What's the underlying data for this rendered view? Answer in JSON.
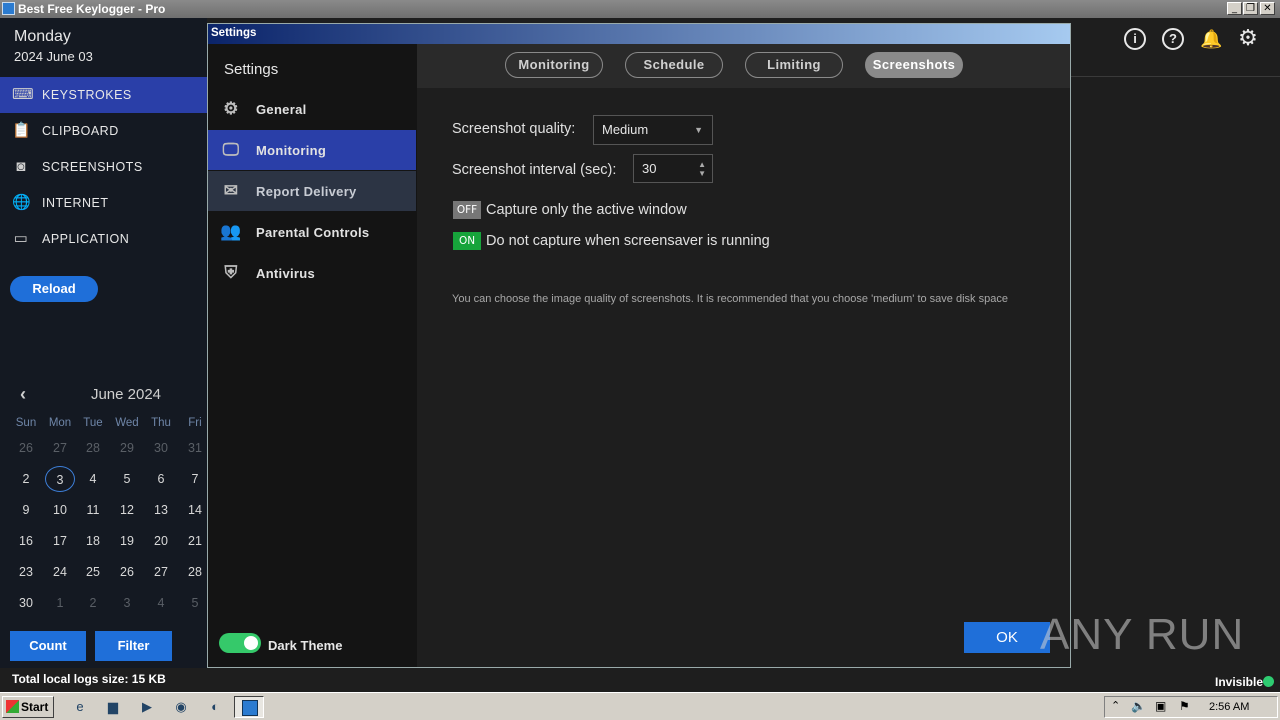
{
  "window": {
    "title": "Best Free Keylogger - Pro"
  },
  "app": {
    "day": "Monday",
    "date": "2024 June 03",
    "nav": [
      {
        "label": "KEYSTROKES",
        "icon": "keyboard-icon",
        "active": true
      },
      {
        "label": "CLIPBOARD",
        "icon": "clipboard-icon",
        "active": false
      },
      {
        "label": "SCREENSHOTS",
        "icon": "camera-icon",
        "active": false
      },
      {
        "label": "INTERNET",
        "icon": "globe-icon",
        "active": false
      },
      {
        "label": "APPLICATION",
        "icon": "window-icon",
        "active": false
      }
    ],
    "reload_label": "Reload",
    "calendar": {
      "month": "June 2024",
      "weekdays": [
        "Sun",
        "Mon",
        "Tue",
        "Wed",
        "Thu",
        "Fri"
      ],
      "weeks": [
        [
          "26",
          "27",
          "28",
          "29",
          "30",
          "31"
        ],
        [
          "2",
          "3",
          "4",
          "5",
          "6",
          "7"
        ],
        [
          "9",
          "10",
          "11",
          "12",
          "13",
          "14"
        ],
        [
          "16",
          "17",
          "18",
          "19",
          "20",
          "21"
        ],
        [
          "23",
          "24",
          "25",
          "26",
          "27",
          "28"
        ],
        [
          "30",
          "1",
          "2",
          "3",
          "4",
          "5"
        ]
      ],
      "selected": "3"
    },
    "count_label": "Count",
    "filter_label": "Filter",
    "logs_size": "Total local logs size: 15 KB",
    "status": "Invisible",
    "status_color": "#2ecc71"
  },
  "settings": {
    "title": "Settings",
    "sidebar_heading": "Settings",
    "items": [
      {
        "label": "General",
        "icon": "gear-icon"
      },
      {
        "label": "Monitoring",
        "icon": "monitor-icon"
      },
      {
        "label": "Report Delivery",
        "icon": "envelope-icon"
      },
      {
        "label": "Parental Controls",
        "icon": "users-icon"
      },
      {
        "label": "Antivirus",
        "icon": "shield-window-icon"
      }
    ],
    "dark_theme_label": "Dark Theme",
    "tabs": [
      "Monitoring",
      "Schedule",
      "Limiting",
      "Screenshots"
    ],
    "active_tab": "Screenshots",
    "quality_label": "Screenshot quality:",
    "quality_value": "Medium",
    "interval_label": "Screenshot interval (sec):",
    "interval_value": "30",
    "opt_active_window": {
      "state": "OFF",
      "label": "Capture only the active window"
    },
    "opt_screensaver": {
      "state": "ON",
      "label": "Do not capture when screensaver is running"
    },
    "note": "You can choose the image quality of screenshots. It is recommended that you choose 'medium' to save disk space",
    "ok_label": "OK",
    "accent": "#1f6fd9"
  },
  "watermark": "ANY RUN",
  "taskbar": {
    "start_label": "Start",
    "clock": "2:56 AM"
  }
}
